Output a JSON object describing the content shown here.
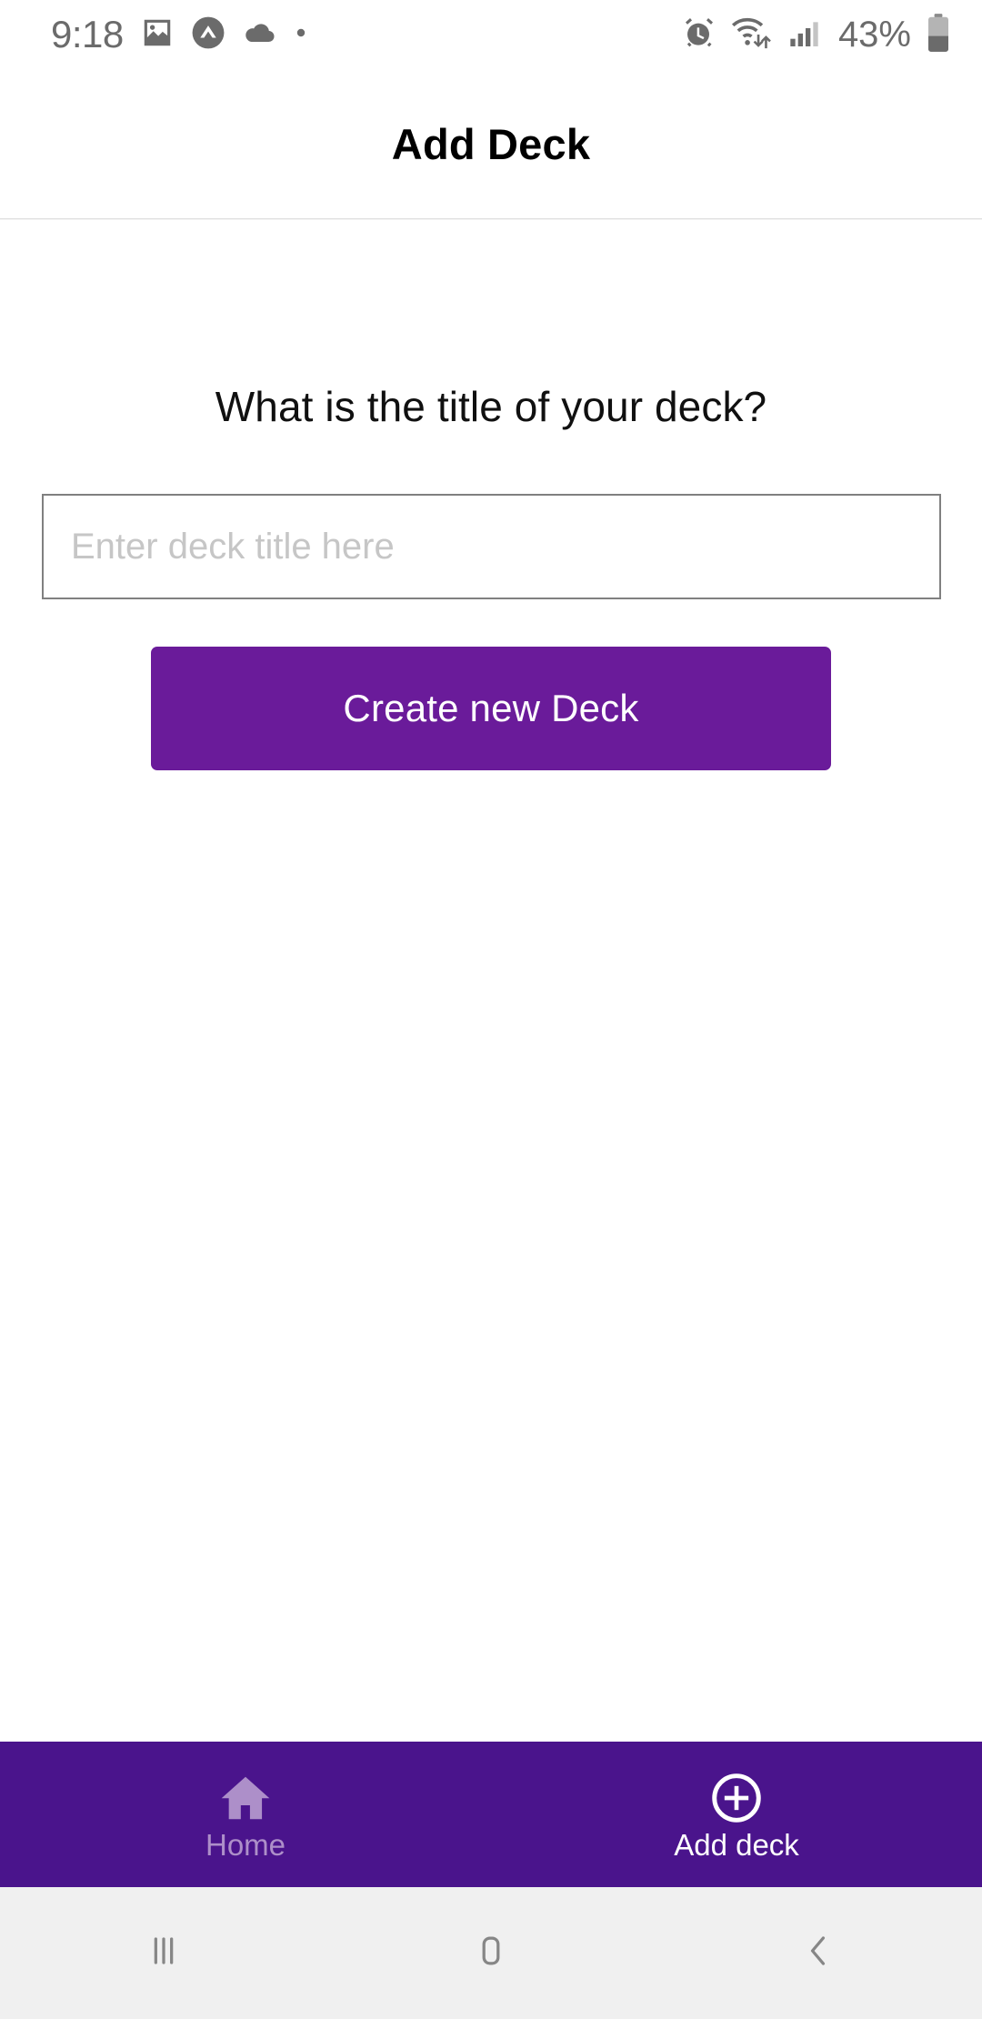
{
  "status_bar": {
    "time": "9:18",
    "battery_percent": "43%",
    "left_icons": [
      {
        "name": "photo-image-icon"
      },
      {
        "name": "circle-caret-up-icon"
      },
      {
        "name": "cloud-icon"
      },
      {
        "name": "dot-indicator-icon"
      }
    ],
    "right_icons": [
      {
        "name": "alarm-clock-icon"
      },
      {
        "name": "wifi-transfer-icon"
      },
      {
        "name": "cellular-signal-icon"
      },
      {
        "name": "battery-icon"
      }
    ]
  },
  "app_bar": {
    "title": "Add Deck"
  },
  "main": {
    "question": "What is the title of your deck?",
    "deck_title_input": {
      "value": "",
      "placeholder": "Enter deck title here"
    },
    "create_button_label": "Create new Deck"
  },
  "bottom_nav": {
    "items": [
      {
        "label": "Home",
        "icon": "home-icon",
        "active": false
      },
      {
        "label": "Add deck",
        "icon": "plus-circle-icon",
        "active": true
      }
    ]
  },
  "system_nav": {
    "recents_label": "Recents",
    "home_label": "Home",
    "back_label": "Back"
  },
  "colors": {
    "primary_button": "#6A1B9A",
    "bottom_nav": "#4A148C",
    "inactive_nav_label": "#ad8fc9",
    "active_nav_label": "#ffffff",
    "input_border": "#808080",
    "placeholder": "#c6c6c6",
    "status_text": "#6b6b6b",
    "system_nav_bg": "#f0f0f0"
  }
}
